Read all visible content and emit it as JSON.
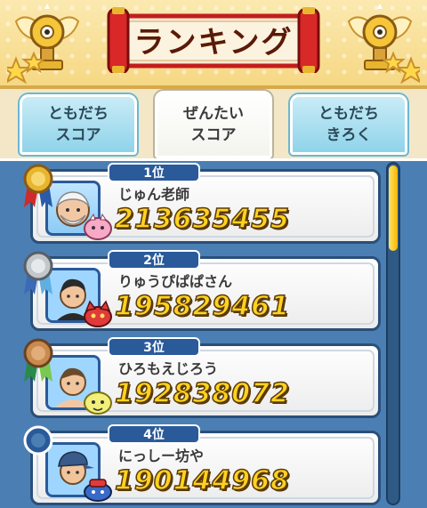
{
  "header": {
    "title": "ランキング"
  },
  "tabs": [
    {
      "label": "ともだち\nスコア",
      "active": false
    },
    {
      "label": "ぜんたい\nスコア",
      "active": true
    },
    {
      "label": "ともだち\nきろく",
      "active": false
    }
  ],
  "ranking": [
    {
      "rank": "1位",
      "name": "じゅん老師",
      "score": "213635455",
      "medal": "gold"
    },
    {
      "rank": "2位",
      "name": "りゅうぴぱぱさん",
      "score": "195829461",
      "medal": "silver"
    },
    {
      "rank": "3位",
      "name": "ひろもえじろう",
      "score": "192838072",
      "medal": "bronze"
    },
    {
      "rank": "4位",
      "name": "にっしー坊や",
      "score": "190144968",
      "medal": "none"
    }
  ],
  "colors": {
    "panel": "#4b7fb4",
    "score_fill": "#ffd21f",
    "rank_tab": "#2a5a9a",
    "gold": "#e8b530",
    "silver": "#c2c7cc",
    "bronze": "#c88a4e"
  }
}
